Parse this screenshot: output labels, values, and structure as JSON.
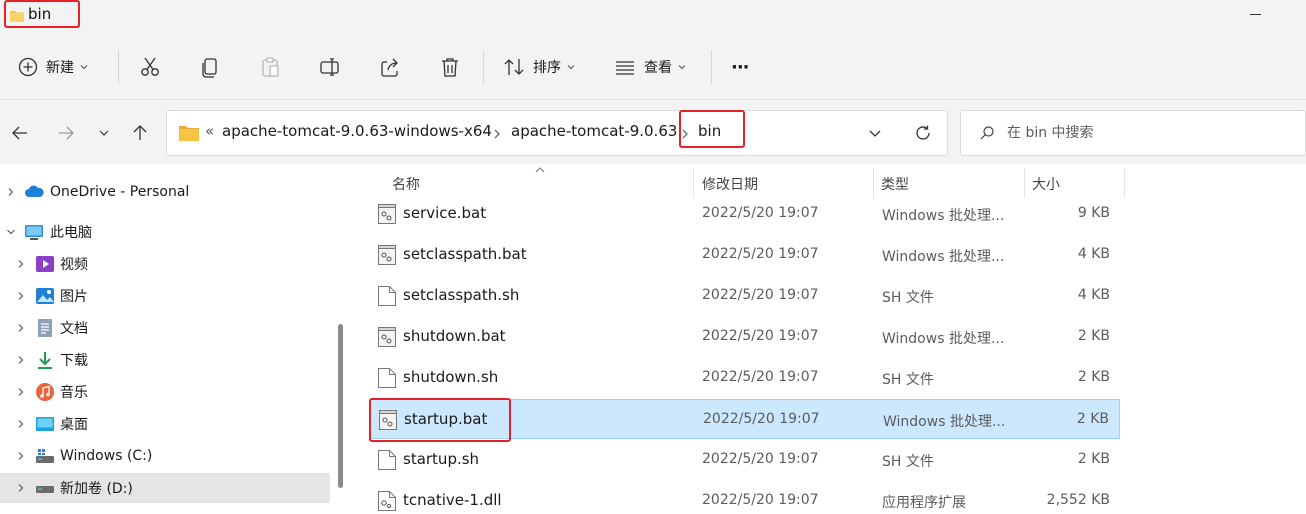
{
  "window": {
    "title": "bin"
  },
  "toolbar": {
    "new_label": "新建",
    "sort_label": "排序",
    "view_label": "查看",
    "more_label": "···"
  },
  "address": {
    "overflow": "«",
    "crumbs": [
      "apache-tomcat-9.0.63-windows-x64",
      "apache-tomcat-9.0.63",
      "bin"
    ]
  },
  "search": {
    "placeholder": "在 bin 中搜索"
  },
  "nav": {
    "items": [
      {
        "label": "OneDrive - Personal",
        "icon": "cloud-icon"
      },
      {
        "label": "此电脑",
        "icon": "computer-icon"
      },
      {
        "label": "视频",
        "icon": "video-icon"
      },
      {
        "label": "图片",
        "icon": "picture-icon"
      },
      {
        "label": "文档",
        "icon": "document-icon"
      },
      {
        "label": "下载",
        "icon": "download-icon"
      },
      {
        "label": "音乐",
        "icon": "music-icon"
      },
      {
        "label": "桌面",
        "icon": "desktop-icon"
      },
      {
        "label": "Windows (C:)",
        "icon": "drive-icon"
      },
      {
        "label": "新加卷 (D:)",
        "icon": "drive-icon"
      }
    ]
  },
  "columns": {
    "name": "名称",
    "date": "修改日期",
    "type": "类型",
    "size": "大小"
  },
  "files": [
    {
      "name": "service.bat",
      "date": "2022/5/20 19:07",
      "type": "Windows 批处理...",
      "size": "9 KB",
      "icon": "batch-file-icon"
    },
    {
      "name": "setclasspath.bat",
      "date": "2022/5/20 19:07",
      "type": "Windows 批处理...",
      "size": "4 KB",
      "icon": "batch-file-icon"
    },
    {
      "name": "setclasspath.sh",
      "date": "2022/5/20 19:07",
      "type": "SH 文件",
      "size": "4 KB",
      "icon": "file-icon"
    },
    {
      "name": "shutdown.bat",
      "date": "2022/5/20 19:07",
      "type": "Windows 批处理...",
      "size": "2 KB",
      "icon": "batch-file-icon"
    },
    {
      "name": "shutdown.sh",
      "date": "2022/5/20 19:07",
      "type": "SH 文件",
      "size": "2 KB",
      "icon": "file-icon"
    },
    {
      "name": "startup.bat",
      "date": "2022/5/20 19:07",
      "type": "Windows 批处理...",
      "size": "2 KB",
      "icon": "batch-file-icon"
    },
    {
      "name": "startup.sh",
      "date": "2022/5/20 19:07",
      "type": "SH 文件",
      "size": "2 KB",
      "icon": "file-icon"
    },
    {
      "name": "tcnative-1.dll",
      "date": "2022/5/20 19:07",
      "type": "应用程序扩展",
      "size": "2,552 KB",
      "icon": "dll-file-icon"
    }
  ],
  "colors": {
    "highlight": "#e8202a",
    "selection": "#cce8ff",
    "folder": "#f5c443"
  }
}
